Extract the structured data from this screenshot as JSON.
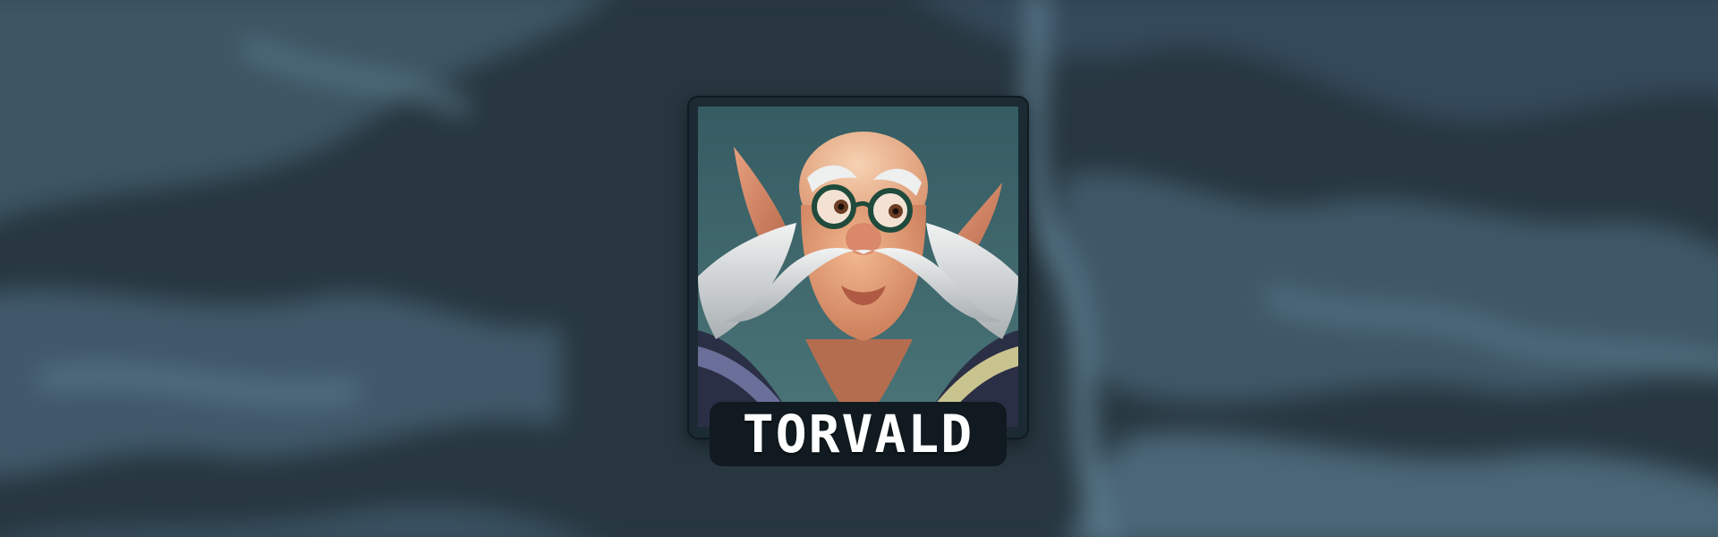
{
  "hero": {
    "name": "TORVALD",
    "portrait_icon": "gnome-elder-portrait-icon"
  },
  "colors": {
    "background_dark": "#1f2d36",
    "background_light": "#4f6d7c",
    "card_frame": "#1b2a33",
    "portrait_backdrop": "#3f6a6d",
    "name_text": "#ffffff"
  }
}
